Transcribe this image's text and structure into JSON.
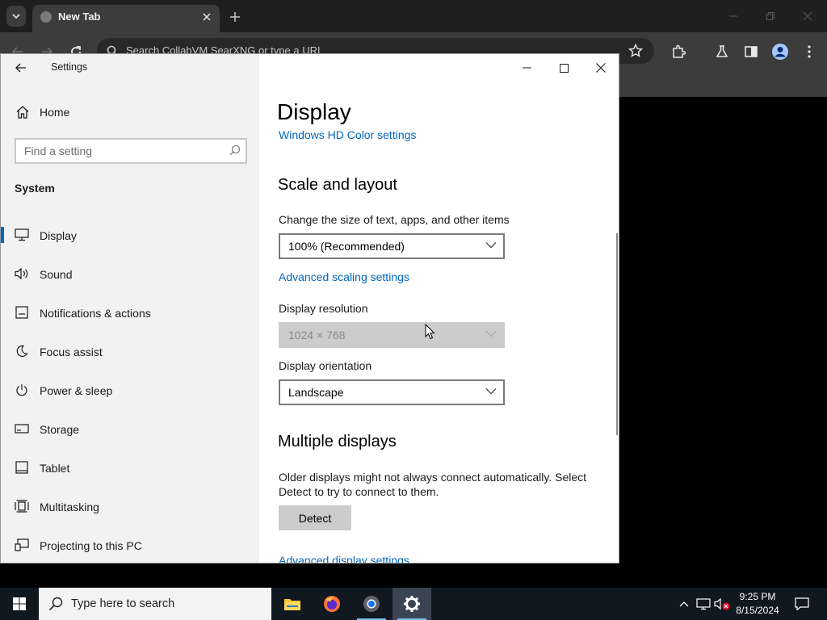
{
  "chrome": {
    "tab_title": "New Tab",
    "omnibox_placeholder": "Search CollabVM SearXNG or type a URL"
  },
  "settings": {
    "window_title": "Settings",
    "home_label": "Home",
    "search_placeholder": "Find a setting",
    "section_label": "System",
    "nav_items": [
      {
        "label": "Display",
        "icon": "monitor-icon",
        "selected": true
      },
      {
        "label": "Sound",
        "icon": "speaker-icon"
      },
      {
        "label": "Notifications & actions",
        "icon": "notification-icon"
      },
      {
        "label": "Focus assist",
        "icon": "moon-icon"
      },
      {
        "label": "Power & sleep",
        "icon": "power-icon"
      },
      {
        "label": "Storage",
        "icon": "storage-icon"
      },
      {
        "label": "Tablet",
        "icon": "tablet-icon"
      },
      {
        "label": "Multitasking",
        "icon": "multitasking-icon"
      },
      {
        "label": "Projecting to this PC",
        "icon": "projecting-icon"
      }
    ],
    "page_title": "Display",
    "hd_color_link": "Windows HD Color settings",
    "scale_heading": "Scale and layout",
    "scale_label": "Change the size of text, apps, and other items",
    "scale_value": "100% (Recommended)",
    "advanced_scaling_link": "Advanced scaling settings",
    "resolution_label": "Display resolution",
    "resolution_value": "1024 × 768",
    "orientation_label": "Display orientation",
    "orientation_value": "Landscape",
    "multiple_heading": "Multiple displays",
    "multiple_desc_line1": "Older displays might not always connect automatically. Select",
    "multiple_desc_line2": "Detect to try to connect to them.",
    "detect_button": "Detect",
    "advanced_display_link": "Advanced display settings"
  },
  "taskbar": {
    "search_text": "Type here to search",
    "time": "9:25 PM",
    "date": "8/15/2024"
  },
  "colors": {
    "accent": "#0067c0",
    "sidebar_bg": "#f2f2f2",
    "taskbar_bg": "#101820"
  }
}
